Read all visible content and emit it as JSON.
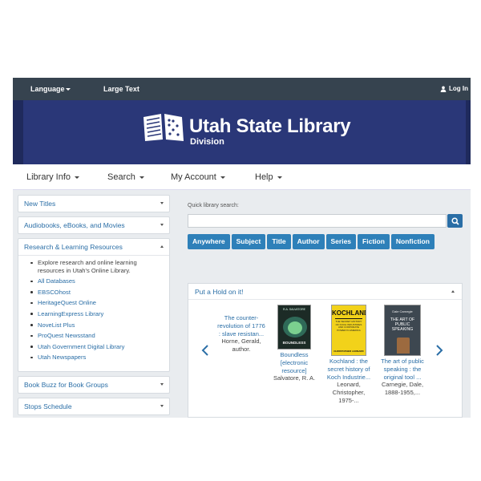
{
  "topbar": {
    "language": "Language",
    "large_text": "Large Text",
    "login": "Log In"
  },
  "banner": {
    "title": "Utah State Library",
    "subtitle": "Division"
  },
  "nav": {
    "items": [
      "Library Info",
      "Search",
      "My Account",
      "Help"
    ]
  },
  "sidebar": {
    "panels": [
      {
        "label": "New Titles"
      },
      {
        "label": "Audiobooks, eBooks, and Movies"
      },
      {
        "label": "Research & Learning Resources"
      },
      {
        "label": "Book Buzz for Book Groups"
      },
      {
        "label": "Stops Schedule"
      }
    ],
    "research_items": [
      "Explore research and online learning resources in Utah's Online Library.",
      "All Databases",
      "EBSCOhost",
      "HeritageQuest Online",
      "LearningExpress Library",
      "NoveList Plus",
      "ProQuest Newsstand",
      "Utah Government Digital Library",
      "Utah Newspapers"
    ]
  },
  "search": {
    "label": "Quick library search:",
    "value": "",
    "filters": [
      "Anywhere",
      "Subject",
      "Title",
      "Author",
      "Series",
      "Fiction",
      "Nonfiction"
    ]
  },
  "hold": {
    "title": "Put a Hold on it!",
    "books": [
      {
        "title": "The counter-revolution of 1776 : slave resistan...",
        "author": "Horne, Gerald, author."
      },
      {
        "title": "Boundless [electronic resource]",
        "author": "Salvatore, R. A."
      },
      {
        "title": "Kochland : the secret history of Koch Industrie...",
        "author": "Leonard, Christopher, 1975-..."
      },
      {
        "title": "The art of public speaking : the original tool ...",
        "author": "Carnegie, Dale, 1888-1955,..."
      }
    ],
    "covers": {
      "boundless_author": "R.A. SALVATORE",
      "boundless_title": "BOUNDLESS",
      "kochland_title": "KOCHLAND",
      "kochland_sub": "THE SECRET HISTORY OF KOCH INDUSTRIES AND CORPORATE POWER IN AMERICA",
      "kochland_author": "CHRISTOPHER LEONARD",
      "carnegie_author": "Dale Carnegie",
      "carnegie_title": "THE ART OF PUBLIC SPEAKING"
    }
  },
  "colors": {
    "topbar": "#36434f",
    "banner": "#2a3778",
    "link": "#2a6ea6",
    "button": "#2e80b9"
  }
}
